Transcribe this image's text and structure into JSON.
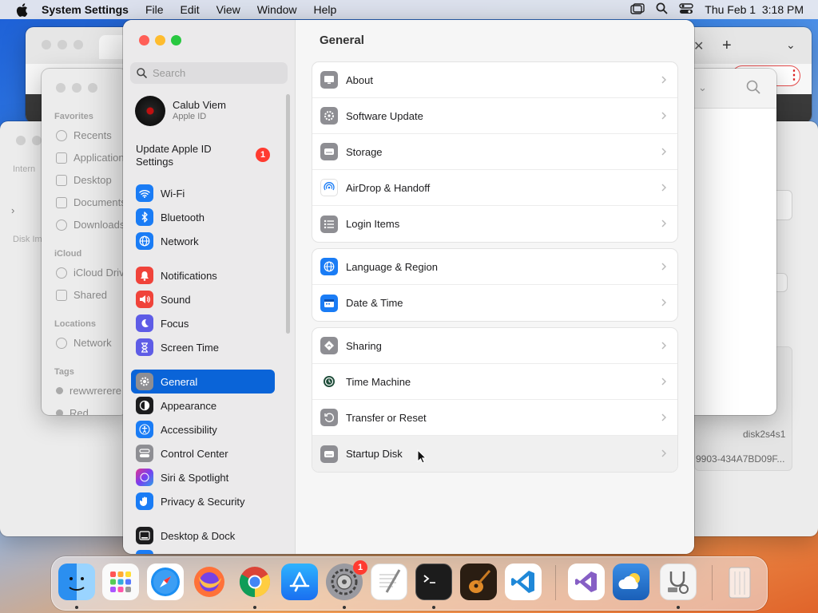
{
  "menubar": {
    "app_name": "System Settings",
    "items": [
      "File",
      "Edit",
      "View",
      "Window",
      "Help"
    ],
    "clock": "Thu Feb 1  3:18 PM"
  },
  "finder": {
    "favorites_header": "Favorites",
    "favorites": [
      "Recents",
      "Applications",
      "Desktop",
      "Documents",
      "Downloads"
    ],
    "icloud_header": "iCloud",
    "icloud": [
      "iCloud Drive",
      "Shared"
    ],
    "locations_header": "Locations",
    "locations": [
      "Network"
    ],
    "tags_header": "Tags",
    "tags": [
      "rewwrerere",
      "Red"
    ]
  },
  "disk_utility": {
    "partial_labels": [
      "Intern",
      "Disk Im"
    ],
    "disk_id": "disk2s4s1",
    "uuid": "9903-434A7BD09F..."
  },
  "settings": {
    "search_placeholder": "Search",
    "account_name": "Calub Viem",
    "account_sub": "Apple ID",
    "update_label": "Update Apple ID Settings",
    "update_badge": "1",
    "sidebar_items": [
      {
        "label": "Wi-Fi",
        "icon": "wifi-icon",
        "color": "#1a7cf5"
      },
      {
        "label": "Bluetooth",
        "icon": "bluetooth-icon",
        "color": "#1a7cf5"
      },
      {
        "label": "Network",
        "icon": "globe-icon",
        "color": "#1a7cf5"
      },
      {
        "label": "Notifications",
        "icon": "bell-icon",
        "color": "#f0433a"
      },
      {
        "label": "Sound",
        "icon": "speaker-icon",
        "color": "#f0433a"
      },
      {
        "label": "Focus",
        "icon": "moon-icon",
        "color": "#5e5ce6"
      },
      {
        "label": "Screen Time",
        "icon": "hourglass-icon",
        "color": "#5e5ce6"
      },
      {
        "label": "General",
        "icon": "gear-icon",
        "color": "#8e8e93",
        "selected": true
      },
      {
        "label": "Appearance",
        "icon": "appearance-icon",
        "color": "#1c1c1e"
      },
      {
        "label": "Accessibility",
        "icon": "accessibility-icon",
        "color": "#1a7cf5"
      },
      {
        "label": "Control Center",
        "icon": "control-center-icon",
        "color": "#8e8e93"
      },
      {
        "label": "Siri & Spotlight",
        "icon": "siri-icon",
        "color": "#7a3ef0"
      },
      {
        "label": "Privacy & Security",
        "icon": "hand-icon",
        "color": "#1a7cf5"
      },
      {
        "label": "Desktop & Dock",
        "icon": "dock-icon",
        "color": "#1c1c1e"
      }
    ],
    "main_title": "General",
    "groups": [
      [
        {
          "label": "About",
          "icon": "about-icon",
          "color": "#8e8e93"
        },
        {
          "label": "Software Update",
          "icon": "software-update-icon",
          "color": "#8e8e93"
        },
        {
          "label": "Storage",
          "icon": "storage-icon",
          "color": "#8e8e93"
        },
        {
          "label": "AirDrop & Handoff",
          "icon": "airdrop-icon",
          "color": "#ffffff"
        },
        {
          "label": "Login Items",
          "icon": "list-icon",
          "color": "#8e8e93"
        }
      ],
      [
        {
          "label": "Language & Region",
          "icon": "globe-icon",
          "color": "#1a7cf5"
        },
        {
          "label": "Date & Time",
          "icon": "calendar-icon",
          "color": "#1a7cf5"
        }
      ],
      [
        {
          "label": "Sharing",
          "icon": "sharing-icon",
          "color": "#8e8e93"
        },
        {
          "label": "Time Machine",
          "icon": "time-machine-icon",
          "color": "#ffffff"
        },
        {
          "label": "Transfer or Reset",
          "icon": "reset-icon",
          "color": "#8e8e93"
        },
        {
          "label": "Startup Disk",
          "icon": "disk-icon",
          "color": "#8e8e93"
        }
      ]
    ]
  },
  "dock": {
    "apps": [
      "Finder",
      "Launchpad",
      "Safari",
      "Firefox",
      "Chrome",
      "App Store",
      "System Settings",
      "TextEdit",
      "Terminal",
      "GarageBand",
      "VS Code",
      "Visual Studio",
      "Weather",
      "Disk Utility",
      "Trash"
    ],
    "settings_badge": "1"
  }
}
